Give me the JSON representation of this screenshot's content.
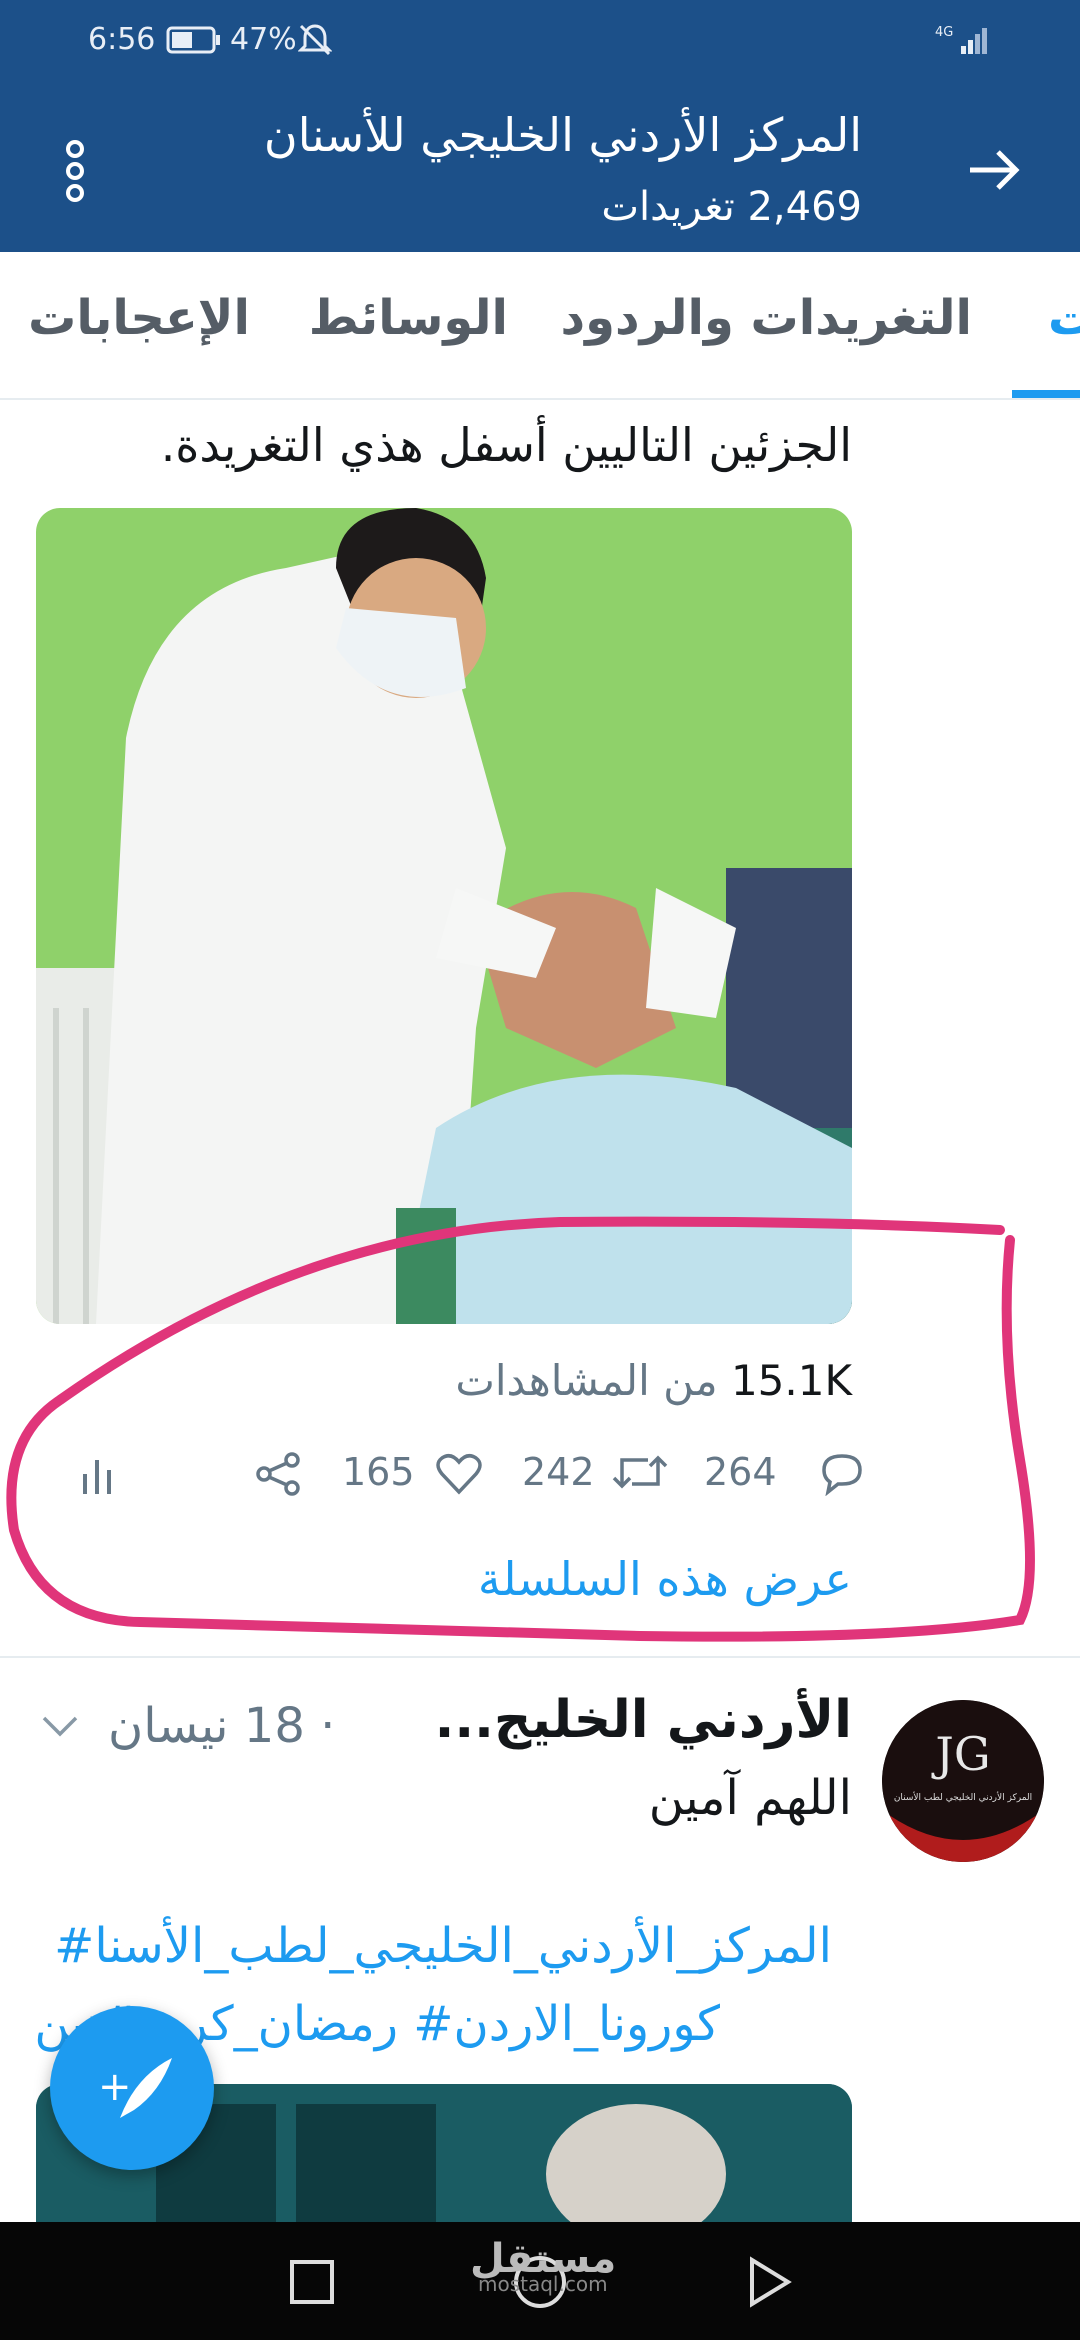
{
  "status_bar": {
    "time": "6:56",
    "battery": "47%",
    "network": "4G"
  },
  "header": {
    "title": "المركز الأردني الخليجي للأسنان",
    "tweet_count": "2,469 تغريدات",
    "bg_color": "#1c5089"
  },
  "tabs": {
    "partial": "ت",
    "items": [
      "التغريدات والردود",
      "الوسائط",
      "الإعجابات"
    ],
    "accent": "#1d9bf0"
  },
  "tweet1": {
    "text": "الجزئين التاليين أسفل هذي التغريدة.",
    "views_count": "15.1K",
    "views_label": "من المشاهدات",
    "replies": "264",
    "retweets": "242",
    "likes": "165",
    "thread_link": "عرض هذه السلسلة"
  },
  "tweet2": {
    "name": "الأردني الخليج...",
    "date": "· 18 نيسان",
    "text": "اللهم آمين",
    "hashtags_line1": "المركز_الأردني_الخليجي_لطب_الأسنا#",
    "hashtags_line2": "كورونا_الاردن# رمضان_كريم#نين",
    "avatar_text": "المركز الأردني الخليجي لطب الأسنان"
  },
  "navbar": {
    "watermark": "مستقل",
    "watermark_sub": "mostaql.com"
  },
  "colors": {
    "annotation": "#e0357a",
    "link": "#1d9bf0"
  }
}
